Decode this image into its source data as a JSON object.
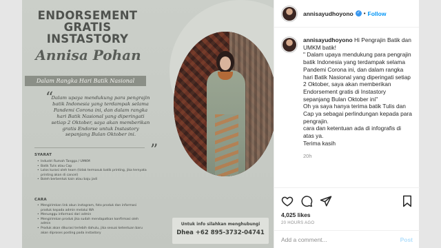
{
  "poster": {
    "headline": "ENDORSEMENT GRATIS INSTASTORY",
    "name": "Annisa Pohan",
    "subtitle": "Dalam Rangka Hari Batik Nasional",
    "quote": "Dalam upaya mendukung para pengrajin batik Indonesia yang terdampak selama Pandemi Corona ini, dan dalam rangka hari Batik Nasional yang diperingati setiap 2 Oktober, saya akan memberikan gratis Endorse untuk Instastory sepanjang Bulan Oktober ini.",
    "syarat_title": "SYARAT",
    "syarat_items": [
      "Industri Rumah Tangga / UMKM",
      "Batik Tulis atau Cap",
      "Lolos kurasi oleh team (tidak termasuk batik printing, jika ternyata printing akan di cancel)",
      "Boleh berbentuk kain atau baju jadi"
    ],
    "cara_title": "CARA",
    "cara_items": [
      "Mengirimkan link akun instagram, foto produk dan informasi produk kepada admin melalui WA",
      "Menunggu informasi dari admin",
      "Mengirimkan produk jika sudah mendapatkan konfirmasi oleh admin",
      "Produk akan dikurasi terlebih dahulu, jika sesuai ketentuan baru akan diproses posting pada instastory"
    ],
    "contact_label": "Untuk info silahkan menghubungi",
    "contact_phone": "Dhea +62 895-3732-04741"
  },
  "header": {
    "username": "annisayudhoyono",
    "separator": "•",
    "follow_label": "Follow"
  },
  "caption": {
    "username": "annisayudhoyono",
    "lines": [
      "Hi Pengrajin Batik dan UMKM batik!",
      "\" Dalam upaya mendukung para pengrajin batik Indonesia yang terdampak selama Pandemi Corona ini, dan dalam rangka hari Batik Nasional yang diperingati setiap 2 Oktober, saya akan memberikan Endorsement gratis di Instastory sepanjang Bulan Oktober ini\"",
      "Oh ya saya hanya terima batik Tulis dan Cap ya sebagai perlindungan kepada para pengrajin.",
      "cara dan ketentuan ada di infografis di atas ya.",
      "Terima kasih"
    ],
    "time": "20h"
  },
  "stats": {
    "likes": "4,025 likes",
    "ago": "20 HOURS AGO"
  },
  "comment_box": {
    "placeholder": "Add a comment...",
    "post_label": "Post"
  },
  "icons": [
    "heart-icon",
    "comment-icon",
    "share-icon",
    "bookmark-icon",
    "verified-icon"
  ],
  "colors": {
    "accent": "#0095f6",
    "poster_bg": "#c9ccc6",
    "text": "#262626",
    "muted": "#8e8e8e"
  }
}
